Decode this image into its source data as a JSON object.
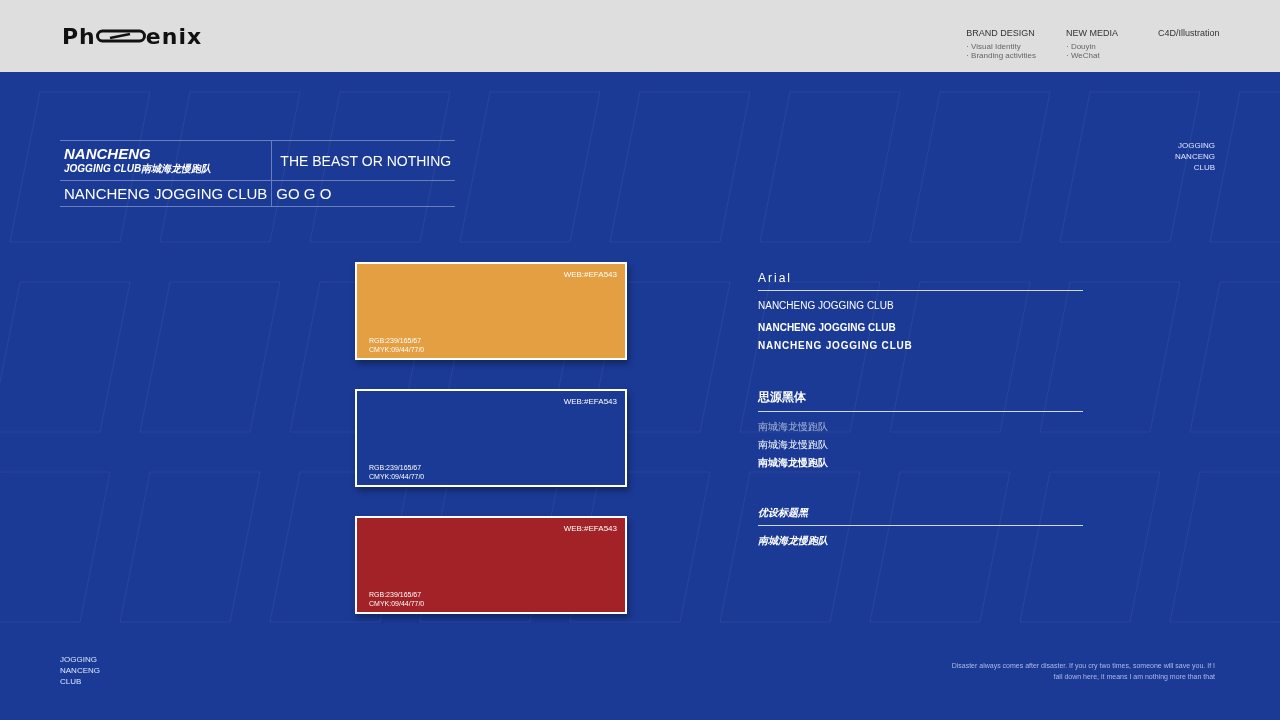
{
  "header": {
    "logo": {
      "prefix": "Ph",
      "suffix": "enix"
    },
    "nav": [
      {
        "title": "BRAND DESIGN",
        "items": [
          "· Visual Identity",
          "· Branding activities"
        ]
      },
      {
        "title": "NEW MEDIA",
        "items": [
          "· Douyin",
          "· WeChat"
        ]
      },
      {
        "title": "C4D/Illustration"
      }
    ]
  },
  "brand_block": {
    "badge_title": "NANCHENG",
    "badge_subtitle": "JOGGING CLUB南城海龙慢跑队",
    "slogan": "THE BEAST OR NOTHING",
    "club_name": "NANCHENG JOGGING CLUB",
    "cheer": "GO G O"
  },
  "corner_label": [
    "JOGGING",
    "NANCENG",
    "CLUB"
  ],
  "swatches": [
    {
      "color": "#e39f42",
      "web": "WEB:#EFA543",
      "rgb": "RGB:239/165/67",
      "cmyk": "CMYK:09/44/77/0"
    },
    {
      "color": "#1b3a95",
      "web": "WEB:#EFA543",
      "rgb": "RGB:239/165/67",
      "cmyk": "CMYK:09/44/77/0"
    },
    {
      "color": "#a32228",
      "web": "WEB:#EFA543",
      "rgb": "RGB:239/165/67",
      "cmyk": "CMYK:09/44/77/0"
    }
  ],
  "fonts": [
    {
      "name": "Arial",
      "kind": "latin",
      "samples": [
        {
          "text": "NANCHENG JOGGING CLUB",
          "kind": "regular"
        },
        {
          "text": "NANCHENG JOGGING CLUB",
          "kind": "bold"
        },
        {
          "text": "NANCHENG JOGGING CLUB",
          "kind": "heavy"
        }
      ]
    },
    {
      "name": "思源黑体",
      "kind": "cjk",
      "samples": [
        {
          "text": "南城海龙慢跑队",
          "kind": "light"
        },
        {
          "text": "南城海龙慢跑队",
          "kind": "regular"
        },
        {
          "text": "南城海龙慢跑队",
          "kind": "bold"
        }
      ]
    },
    {
      "name": "优设标题黑",
      "kind": "italic",
      "samples": [
        {
          "text": "南城海龙慢跑队",
          "kind": "bold"
        }
      ]
    }
  ],
  "footer_label": [
    "JOGGING",
    "NANCENG",
    "CLUB"
  ],
  "quote": [
    "Disaster always comes after disaster. If you cry two times, someone will save you. If I",
    "fall down here, it means I am nothing more than that"
  ]
}
